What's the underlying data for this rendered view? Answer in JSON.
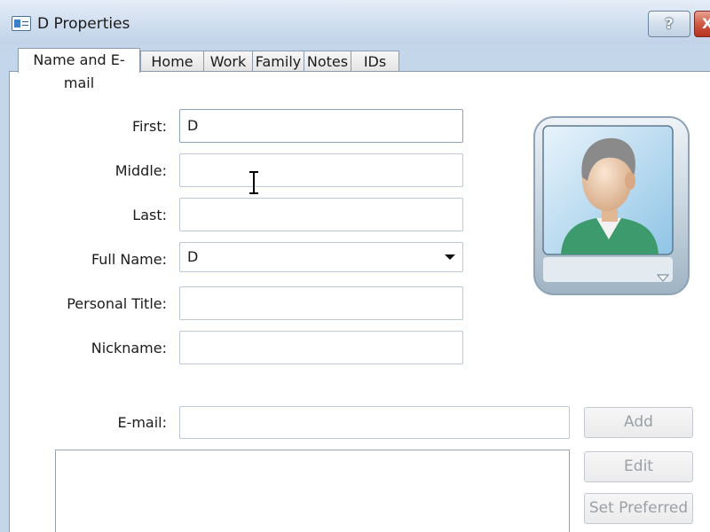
{
  "window": {
    "title": "D Properties",
    "icon": "contact-card-icon",
    "help_label": "?",
    "close_label": "X"
  },
  "tabs": [
    {
      "label": "Name and E-mail",
      "selected": true
    },
    {
      "label": "Home"
    },
    {
      "label": "Work"
    },
    {
      "label": "Family"
    },
    {
      "label": "Notes"
    },
    {
      "label": "IDs"
    }
  ],
  "form": {
    "first": {
      "label": "First:",
      "value": "D"
    },
    "middle": {
      "label": "Middle:",
      "value": ""
    },
    "last": {
      "label": "Last:",
      "value": ""
    },
    "full_name": {
      "label": "Full Name:",
      "value": "D"
    },
    "personal_title": {
      "label": "Personal Title:",
      "value": ""
    },
    "nickname": {
      "label": "Nickname:",
      "value": ""
    }
  },
  "email": {
    "label": "E-mail:",
    "value": "",
    "buttons": {
      "add": "Add",
      "edit": "Edit",
      "set_preferred": "Set Preferred"
    }
  },
  "avatar": {
    "icon": "contact-avatar-icon",
    "menu_icon": "chevron-down-icon"
  },
  "colors": {
    "titlebar": "#c9d9ec",
    "disabled_text": "#9aa0a6",
    "avatar_shirt": "#3c9a6c"
  }
}
